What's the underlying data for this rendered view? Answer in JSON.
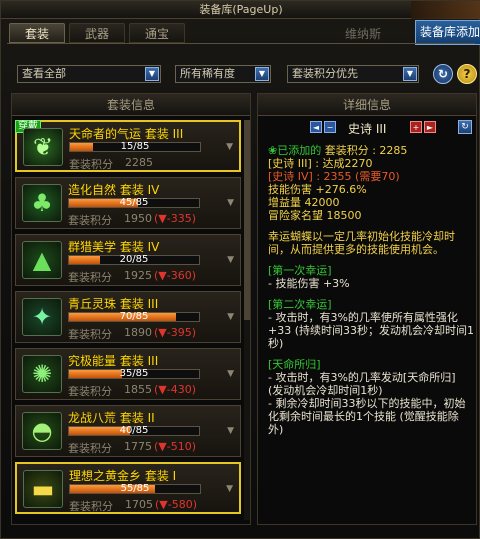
{
  "window": {
    "title": "装备库(PageUp)",
    "storage_button": "装备库添加",
    "town": "维纳斯"
  },
  "tabs": [
    {
      "label": "套装",
      "active": true
    },
    {
      "label": "武器",
      "active": false
    },
    {
      "label": "通宝",
      "active": false
    }
  ],
  "filters": {
    "view": "查看全部",
    "rarity": "所有稀有度",
    "sort": "套装积分优先"
  },
  "left_panel": {
    "title": "套装信息",
    "equipped_badge": "穿戴",
    "score_label": "套装积分",
    "suits": [
      {
        "name": "天命者的气运 套装 III",
        "progress": "15/85",
        "fill": 0.18,
        "score": "2285",
        "delta": "",
        "icon": "leaf-icon",
        "selected": true
      },
      {
        "name": "造化自然 套装 IV",
        "progress": "45/85",
        "fill": 0.53,
        "score": "1950",
        "delta": "(▼-335)",
        "icon": "tree-icon"
      },
      {
        "name": "群猎美学 套装 IV",
        "progress": "20/85",
        "fill": 0.24,
        "score": "1925",
        "delta": "(▼-360)",
        "icon": "wolf-icon"
      },
      {
        "name": "青丘灵珠 套装 III",
        "progress": "70/85",
        "fill": 0.82,
        "score": "1890",
        "delta": "(▼-395)",
        "icon": "fox-icon"
      },
      {
        "name": "究极能量 套装 III",
        "progress": "35/85",
        "fill": 0.41,
        "score": "1855",
        "delta": "(▼-430)",
        "icon": "energy-icon"
      },
      {
        "name": "龙战八荒 套装 II",
        "progress": "40/85",
        "fill": 0.47,
        "score": "1775",
        "delta": "(▼-510)",
        "icon": "sunrise-icon"
      },
      {
        "name": "理想之黄金乡 套装 I",
        "progress": "55/85",
        "fill": 0.65,
        "score": "1705",
        "delta": "(▼-580)",
        "icon": "gold-icon",
        "highlight": true
      }
    ]
  },
  "right_panel": {
    "title": "详细信息",
    "rarity": "史诗 III",
    "added_label": "已添加的",
    "score_label": "套装积分 : 2285",
    "lines": [
      "[史诗 III] : 达成2270",
      "[史诗 IV] : 2355 (需要70)",
      "技能伤害 +276.6%",
      "增益量 42000",
      "冒险家名望 18500"
    ],
    "desc": "幸运蝴蝶以一定几率初始化技能冷却时间，从而提供更多的技能使用机会。",
    "sections": [
      {
        "title": "[第一次幸运]",
        "body": "- 技能伤害 +3%"
      },
      {
        "title": "[第二次幸运]",
        "body": "- 攻击时，有3%的几率使所有属性强化 +33 (持续时间33秒；发动机会冷却时间1秒)"
      },
      {
        "title": "[天命所归]",
        "body": "- 攻击时，有3%的几率发动[天命所归] (发动机会冷却时间1秒)\n- 剩余冷却时间33秒以下的技能中，初始化剩余时间最长的1个技能 (觉醒技能除外)"
      }
    ]
  },
  "colors": {
    "accent_gold": "#ffd700",
    "progress_orange": "#ff9a3a",
    "delta_red": "#e0352d",
    "green": "#34c634"
  }
}
